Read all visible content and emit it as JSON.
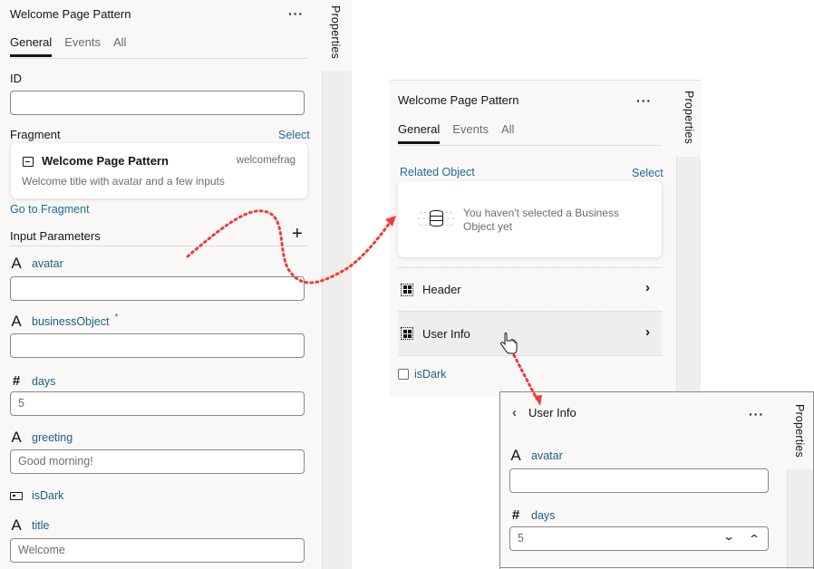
{
  "side_tab_label": "Properties",
  "left_panel": {
    "title": "Welcome Page Pattern",
    "more_icon": "ellipsis-icon",
    "tabs": [
      {
        "label": "General",
        "active": true
      },
      {
        "label": "Events",
        "active": false
      },
      {
        "label": "All",
        "active": false
      }
    ],
    "id_label": "ID",
    "id_value": "",
    "fragment_label": "Fragment",
    "fragment_select": "Select",
    "fragment_card": {
      "icon": "fragment-icon",
      "name": "Welcome Page Pattern",
      "id": "welcomefrag",
      "description": "Welcome title with avatar and a few inputs"
    },
    "go_to_fragment": "Go to Fragment",
    "input_parameters_label": "Input Parameters",
    "add_icon": "plus-icon",
    "params": [
      {
        "name": "avatar",
        "type_icon": "text-type-icon",
        "value": "",
        "required": false
      },
      {
        "name": "businessObject",
        "type_icon": "text-type-icon",
        "value": "",
        "required": true,
        "required_mark": "*"
      },
      {
        "name": "days",
        "type_icon": "number-type-icon",
        "value": "5"
      },
      {
        "name": "greeting",
        "type_icon": "text-type-icon",
        "value": "Good morning!"
      },
      {
        "name": "isDark",
        "type_icon": "boolean-type-icon"
      },
      {
        "name": "title",
        "type_icon": "text-type-icon",
        "value": "Welcome"
      }
    ]
  },
  "middle_panel": {
    "title": "Welcome Page Pattern",
    "tabs": [
      {
        "label": "General",
        "active": true
      },
      {
        "label": "Events",
        "active": false
      },
      {
        "label": "All",
        "active": false
      }
    ],
    "related_object_label": "Related Object",
    "related_select": "Select",
    "empty_message": "You haven't selected a Business Object yet",
    "empty_icon": "database-icon",
    "sections": [
      {
        "label": "Header",
        "icon": "container-icon"
      },
      {
        "label": "User Info",
        "icon": "container-icon",
        "hovered": true
      }
    ],
    "checkbox": {
      "label": "isDark",
      "checked": false
    }
  },
  "detail_panel": {
    "back_icon": "chevron-left-icon",
    "title": "User Info",
    "params": [
      {
        "name": "avatar",
        "type_icon": "text-type-icon",
        "value": ""
      },
      {
        "name": "days",
        "type_icon": "number-type-icon",
        "value": "5"
      }
    ]
  },
  "annotations": {
    "arrow_color": "#ef3b3b"
  }
}
